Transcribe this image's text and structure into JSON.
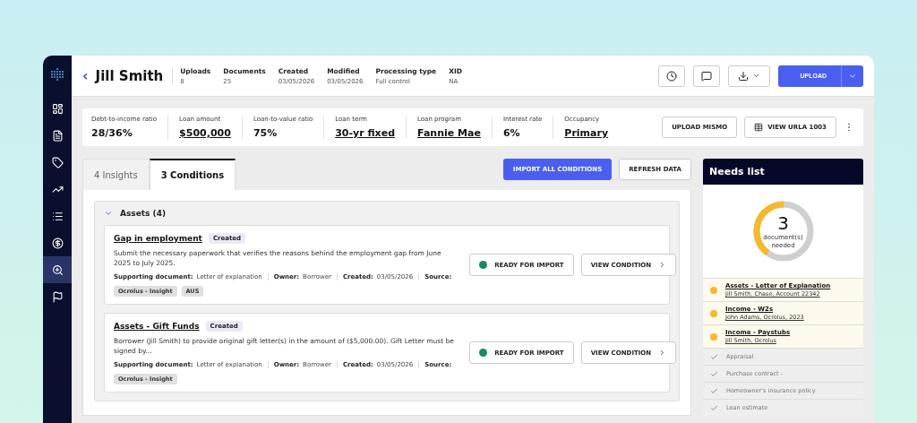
{
  "sidebar": {
    "items": [
      {
        "selected": false
      },
      {
        "selected": false
      },
      {
        "selected": false
      },
      {
        "selected": false
      },
      {
        "selected": false
      },
      {
        "selected": false
      },
      {
        "selected": true
      },
      {
        "selected": false
      }
    ]
  },
  "header": {
    "back": "‹",
    "name": "Jill Smith",
    "stats": [
      {
        "label": "Uploads",
        "value": "8"
      },
      {
        "label": "Documents",
        "value": "25"
      },
      {
        "label": "Created",
        "value": "03/05/2026"
      },
      {
        "label": "Modified",
        "value": "03/05/2026"
      },
      {
        "label": "Processing type",
        "value": "Full control"
      },
      {
        "label": "XID",
        "value": "NA"
      }
    ],
    "upload_button": "UPLOAD"
  },
  "loan": {
    "metrics": [
      {
        "label": "Debt-to-income ratio",
        "value": "28/36%",
        "underlined": false
      },
      {
        "label": "Loan amount",
        "value": "$500,000",
        "underlined": true
      },
      {
        "label": "Loan-to-value ratio",
        "value": "75%",
        "underlined": false
      },
      {
        "label": "Loan term",
        "value": "30-yr fixed",
        "underlined": true
      },
      {
        "label": "Loan program",
        "value": "Fannie Mae",
        "underlined": true
      },
      {
        "label": "Interest rate",
        "value": "6%",
        "underlined": false
      },
      {
        "label": "Occupancy",
        "value": "Primary",
        "underlined": true
      }
    ],
    "buttons": [
      "UPLOAD MISMO",
      "VIEW URLA 1003"
    ]
  },
  "tabs": [
    {
      "label": "4 Insights",
      "selected": false
    },
    {
      "label": "3 Conditions",
      "selected": true
    }
  ],
  "actions": [
    "IMPORT ALL CONDITIONS",
    "REFRESH DATA"
  ],
  "group": {
    "title": "Assets (4)",
    "expanded": true,
    "conditions": [
      {
        "title": "Gap in employment",
        "status": "Created",
        "description": "Submit the necessary paperwork that verifies the reasons behind the employment gap from June 2025 to July 2025.",
        "meta": [
          {
            "label": "Supporting document:",
            "value": "Letter of explanation"
          },
          {
            "label": "Owner:",
            "value": "Borrower"
          },
          {
            "label": "Created:",
            "value": "03/05/2026"
          },
          {
            "label": "Source:"
          }
        ],
        "sources": [
          "Ocrolus - Insight",
          "AUS"
        ],
        "import_status": "READY FOR IMPORT",
        "view": "VIEW CONDITION"
      },
      {
        "title": "Assets - Gift Funds",
        "status": "Created",
        "description": "Borrower (Jill Smith) to provide original gift letter(s) in the amount of ($5,000.00). Gift Letter must be signed by...",
        "meta": [
          {
            "label": "Supporting document:",
            "value": "Letter of explanation"
          },
          {
            "label": "Owner:",
            "value": "Borrower"
          },
          {
            "label": "Created:",
            "value": "03/05/2026"
          },
          {
            "label": "Source:"
          }
        ],
        "sources": [
          "Ocrolus - Insight"
        ],
        "import_status": "READY FOR IMPORT",
        "view": "VIEW CONDITION"
      }
    ]
  },
  "needs_list": {
    "title": "Needs list",
    "count": "3",
    "caption": "document(s) needed",
    "level": 0.4,
    "items": [
      {
        "kind": "pending",
        "title": "Assets - Letter of Explanation",
        "detail": "Jill Smith, Chase, Account 22342"
      },
      {
        "kind": "pending",
        "title": "Income - W2s",
        "detail": "John Adams, Ocrolus, 2023"
      },
      {
        "kind": "pending",
        "title": "Income - Paystubs",
        "detail": "Jill Smith, Ocrolus"
      },
      {
        "kind": "done",
        "title": "Appraisal"
      },
      {
        "kind": "done",
        "title": "Purchase contract -"
      },
      {
        "kind": "done",
        "title": "Homeowner's insurance policy"
      },
      {
        "kind": "done",
        "title": "Loan estimate"
      }
    ]
  }
}
